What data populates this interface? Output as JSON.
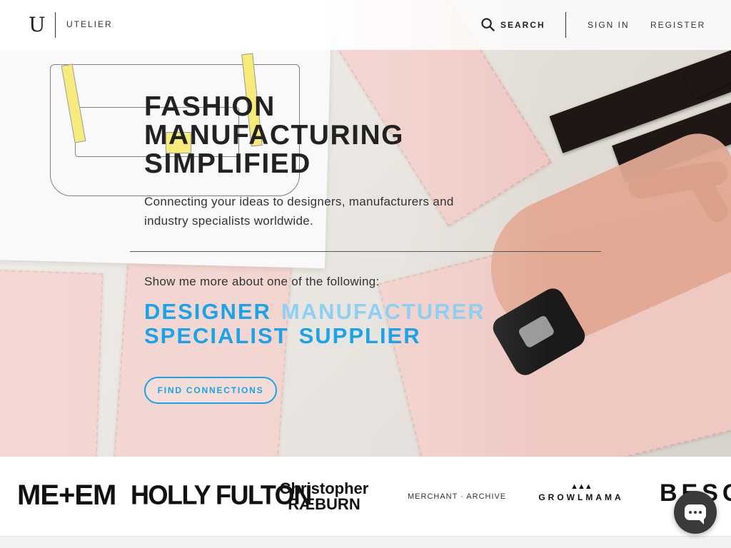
{
  "header": {
    "logo_mark": "U",
    "brand": "UTELIER",
    "search_label": "SEARCH",
    "sign_in": "SIGN IN",
    "register": "REGISTER"
  },
  "hero": {
    "headline": [
      "FASHION",
      "MANUFACTURING",
      "SIMPLIFIED"
    ],
    "subtitle": "Connecting your ideas to designers, manufacturers and industry specialists worldwide.",
    "prompt": "Show me more about one of the following:",
    "roles": [
      "DESIGNER",
      "MANUFACTURER",
      "SPECIALIST",
      "SUPPLIER"
    ],
    "cta": "FIND CONNECTIONS"
  },
  "brands": {
    "items": [
      "ME+EM",
      "HOLLY FULTON",
      "Christopher",
      "RÆBURN",
      "MERCHANT · ARCHIVE",
      "GROWLMAMA",
      "BESC"
    ]
  },
  "colors": {
    "accent": "#1aa3e8",
    "accent_light": "#8fd0f2",
    "text": "#222222",
    "chat_button": "#3a3a3a"
  },
  "icons": {
    "search": "search-icon",
    "chat": "chat-icon"
  }
}
